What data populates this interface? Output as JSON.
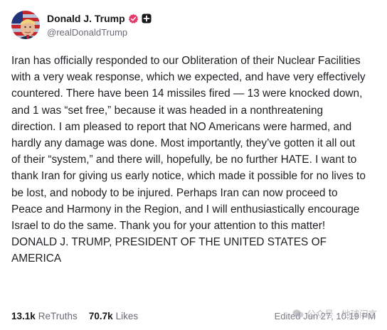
{
  "author": {
    "display_name": "Donald J. Trump",
    "handle": "@realDonaldTrump",
    "verified_icon": "verified-badge-icon",
    "plus_icon": "plus-badge-icon"
  },
  "post": {
    "body": "Iran has officially responded to our Obliteration of their Nuclear Facilities with a very weak response, which we expected, and have very effectively countered. There have been 14 missiles fired — 13 were knocked down, and 1 was “set free,” because it was headed in a nonthreatening direction. I am pleased to report that NO Americans were harmed, and hardly any damage was done. Most importantly, they’ve gotten it all out of their “system,” and there will, hopefully, be no further HATE. I want to thank Iran for giving us early notice, which made it possible for no lives to be lost, and nobody to be injured. Perhaps Iran can now proceed to Peace and Harmony in the Region, and I will enthusiastically encourage Israel to do the same. Thank you for your attention to this matter!",
    "signature": "DONALD J. TRUMP, PRESIDENT OF THE UNITED STATES OF AMERICA"
  },
  "stats": {
    "retruths_count": "13.1k",
    "retruths_label": "ReTruths",
    "likes_count": "70.7k",
    "likes_label": "Likes",
    "edited": "Edited Jun 27, 10:19 PM"
  },
  "watermark": {
    "text": "公众号 · 地球闲言"
  },
  "colors": {
    "verified_badge": "#e5386b",
    "text": "#1f1f23",
    "muted": "#6b6b75"
  }
}
